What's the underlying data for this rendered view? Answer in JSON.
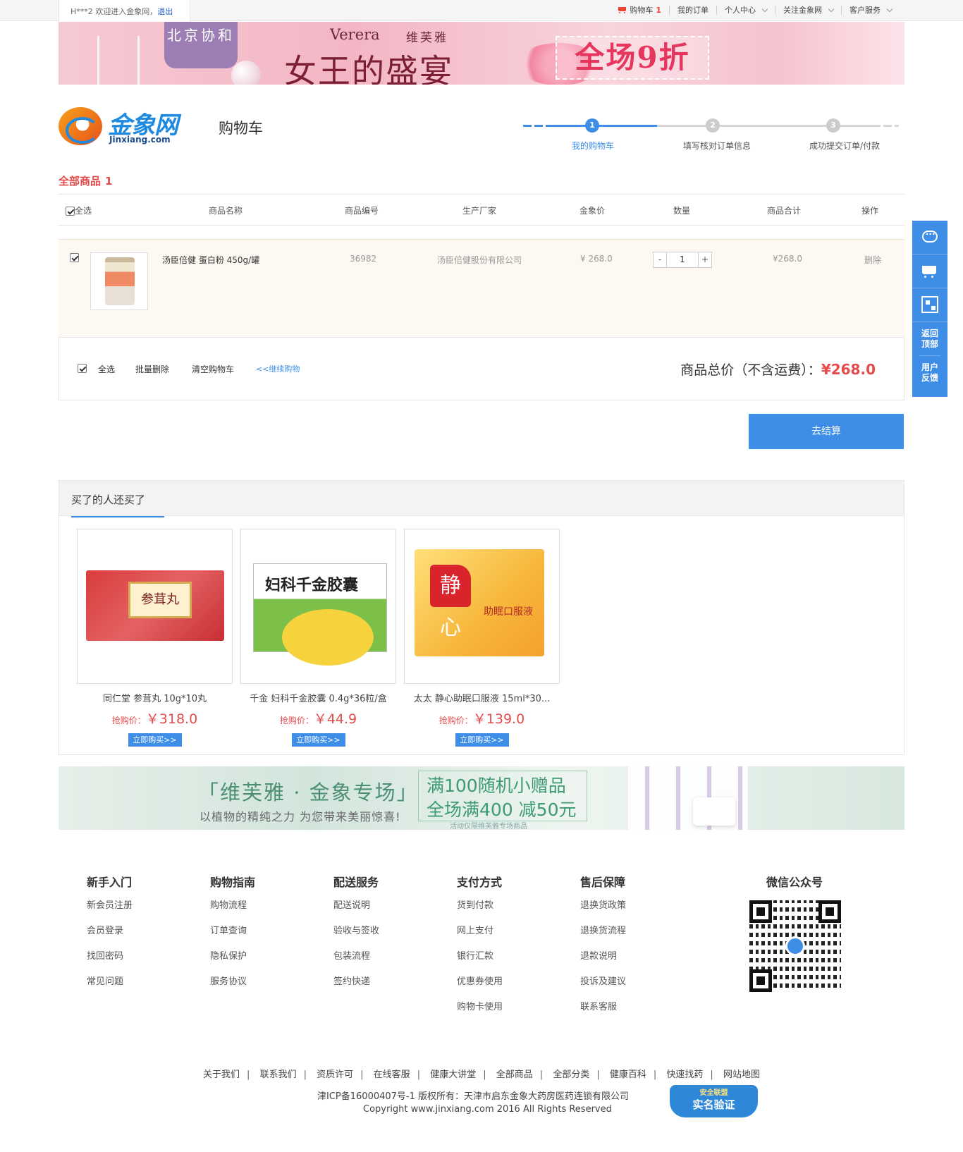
{
  "topbar": {
    "welcome": "H***2 欢迎进入金象网，",
    "logout": "退出",
    "nav": {
      "cart": "购物车",
      "cart_count": "1",
      "orders": "我的订单",
      "account": "个人中心",
      "follow": "关注金象网",
      "service": "客户服务"
    }
  },
  "banner": {
    "badge": "北京协和",
    "brand": "Verera",
    "brand_cn": "维芙雅",
    "title": "女王的盛宴",
    "sale": "全场9折"
  },
  "header": {
    "logo_cn": "金象网",
    "logo_en": "Jinxiang.com",
    "page_title": "购物车",
    "steps": [
      {
        "num": "1",
        "label": "我的购物车"
      },
      {
        "num": "2",
        "label": "填写核对订单信息"
      },
      {
        "num": "3",
        "label": "成功提交订单/付款"
      }
    ],
    "active_step": 1
  },
  "cart": {
    "title": "全部商品",
    "count": "1",
    "columns": {
      "select_all": "全选",
      "name": "商品名称",
      "code": "商品编号",
      "maker": "生产厂家",
      "price": "金象价",
      "qty": "数量",
      "subtotal": "商品合计",
      "action": "操作"
    },
    "items": [
      {
        "name": "汤臣倍健  蛋白粉  450g/罐",
        "code": "36982",
        "maker": "汤臣倍健股份有限公司",
        "price": "¥ 268.0",
        "qty": "1",
        "subtotal": "¥268.0",
        "delete": "删除",
        "checked": true
      }
    ],
    "footer": {
      "select_all": "全选",
      "batch_delete": "批量删除",
      "clear": "清空购物车",
      "continue": "<<继续购物",
      "total_label": "商品总价（不含运费）：",
      "total_value": "¥268.0"
    },
    "checkout": "去结算"
  },
  "recommend": {
    "title": "买了的人还买了",
    "products": [
      {
        "name": "同仁堂  参茸丸  10g*10丸",
        "price_label": "抢购价：",
        "price": "￥318.0",
        "buy": "立即购买>>",
        "box_text": "参茸丸"
      },
      {
        "name": "千金  妇科千金胶囊  0.4g*36粒/盒",
        "price_label": "抢购价：",
        "price": "￥44.9",
        "buy": "立即购买>>",
        "box_text": "妇科千金胶囊"
      },
      {
        "name": "太太  静心助眠口服液  15ml*30...",
        "price_label": "抢购价：",
        "price": "￥139.0",
        "buy": "立即购买>>",
        "box_text": "静心",
        "box_sub": "助眠口服液"
      }
    ]
  },
  "promo": {
    "title": "「维芙雅 · 金象专场」",
    "subtitle": "以植物的精纯之力 为您带来美丽惊喜!",
    "offer1": "满100随机小赠品",
    "offer2": "全场满400 减50元",
    "note": "活动仅限维芙雅专场商品"
  },
  "footer": {
    "columns": [
      {
        "title": "新手入门",
        "links": [
          "新会员注册",
          "会员登录",
          "找回密码",
          "常见问题"
        ]
      },
      {
        "title": "购物指南",
        "links": [
          "购物流程",
          "订单查询",
          "隐私保护",
          "服务协议"
        ]
      },
      {
        "title": "配送服务",
        "links": [
          "配送说明",
          "验收与签收",
          "包装流程",
          "签约快递"
        ]
      },
      {
        "title": "支付方式",
        "links": [
          "货到付款",
          "网上支付",
          "银行汇款",
          "优惠券使用",
          "购物卡使用"
        ]
      },
      {
        "title": "售后保障",
        "links": [
          "退换货政策",
          "退换货流程",
          "退款说明",
          "投诉及建议",
          "联系客服"
        ]
      }
    ],
    "wechat": "微信公众号",
    "links": [
      "关于我们",
      "联系我们",
      "资质许可",
      "在线客服",
      "健康大讲堂",
      "全部商品",
      "全部分类",
      "健康百科",
      "快速找药",
      "网站地图"
    ],
    "icp": "津ICP备16000407号-1 版权所有：天津市启东金象大药房医药连锁有限公司",
    "copyright": "Copyright www.jinxiang.com 2016 All Rights Reserved",
    "badge_top": "安全联盟",
    "badge_main": "实名验证"
  },
  "sidebar": {
    "back_top": "返回顶部",
    "feedback": "用户反馈"
  },
  "colors": {
    "accent": "#3e8ee8",
    "price_red": "#e54b4b"
  }
}
